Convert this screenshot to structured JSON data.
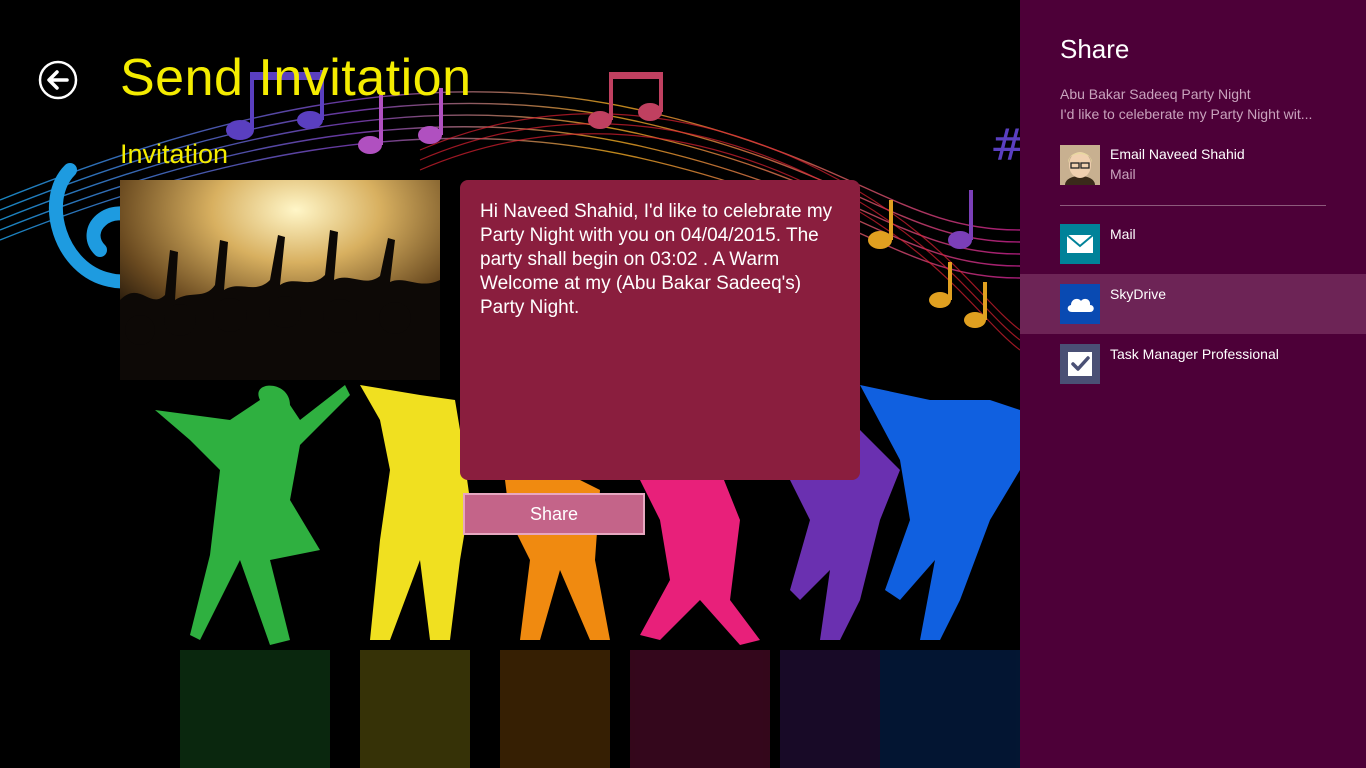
{
  "app": {
    "title": "Send Invitation",
    "section_title": "Invitation",
    "message": "Hi Naveed Shahid, I'd like to celebrate my Party Night with you on 04/04/2015. The party shall begin on 03:02 . A Warm Welcome at my (Abu Bakar Sadeeq's) Party Night.",
    "share_button_label": "Share",
    "back_icon": "back-arrow-icon",
    "colors": {
      "title": "#f4ec00",
      "card": "#8a1e3e",
      "button": "#c46489"
    }
  },
  "share_charm": {
    "title": "Share",
    "subtitle": "Abu Bakar Sadeeq Party Night",
    "description": "I'd like to celeberate my Party Night wit...",
    "quicklink": {
      "name": "Email Naveed Shahid",
      "app": "Mail"
    },
    "targets": [
      {
        "label": "Mail",
        "icon": "mail-icon",
        "color": "#008299"
      },
      {
        "label": "SkyDrive",
        "icon": "cloud-icon",
        "color": "#094ab2"
      },
      {
        "label": "Task Manager Professional",
        "icon": "checkbox-icon",
        "color": "#4a5075"
      }
    ],
    "background": "#4d0038"
  }
}
